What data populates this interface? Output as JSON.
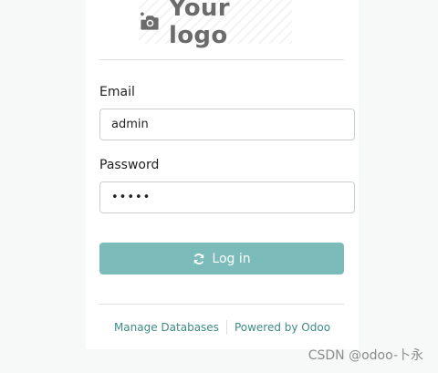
{
  "brand": {
    "logo_text": "Your logo",
    "logo_icon": "add-photo-icon"
  },
  "form": {
    "email_label": "Email",
    "email_value": "admin",
    "password_label": "Password",
    "password_value": "•••••",
    "login_label": "Log in",
    "login_icon": "refresh-icon"
  },
  "footer": {
    "manage_databases": "Manage Databases",
    "powered_by": "Powered by Odoo"
  },
  "watermark": "CSDN @odoo-卜永",
  "colors": {
    "accent": "#7bbcbb",
    "link": "#3e8b87",
    "logo": "#6b6b6b"
  }
}
